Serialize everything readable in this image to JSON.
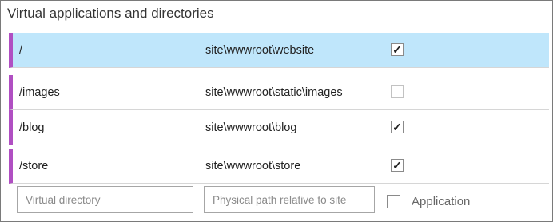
{
  "title": "Virtual applications and directories",
  "rows": [
    {
      "virtual_path": "/",
      "physical_path": "site\\wwwroot\\website",
      "application": true,
      "selected": true,
      "check_mark": "✓"
    },
    {
      "virtual_path": "/images",
      "physical_path": "site\\wwwroot\\static\\images",
      "application": false,
      "selected": false,
      "check_mark": ""
    },
    {
      "virtual_path": "/blog",
      "physical_path": "site\\wwwroot\\blog",
      "application": true,
      "selected": false,
      "check_mark": "✓"
    },
    {
      "virtual_path": "/store",
      "physical_path": "site\\wwwroot\\store",
      "application": true,
      "selected": false,
      "check_mark": "✓"
    }
  ],
  "new_entry": {
    "virtual_placeholder": "Virtual directory",
    "physical_placeholder": "Physical path relative to site",
    "application_label": "Application"
  },
  "colors": {
    "selected_row": "#bfe6fb",
    "row_accent": "#b04fc2"
  }
}
